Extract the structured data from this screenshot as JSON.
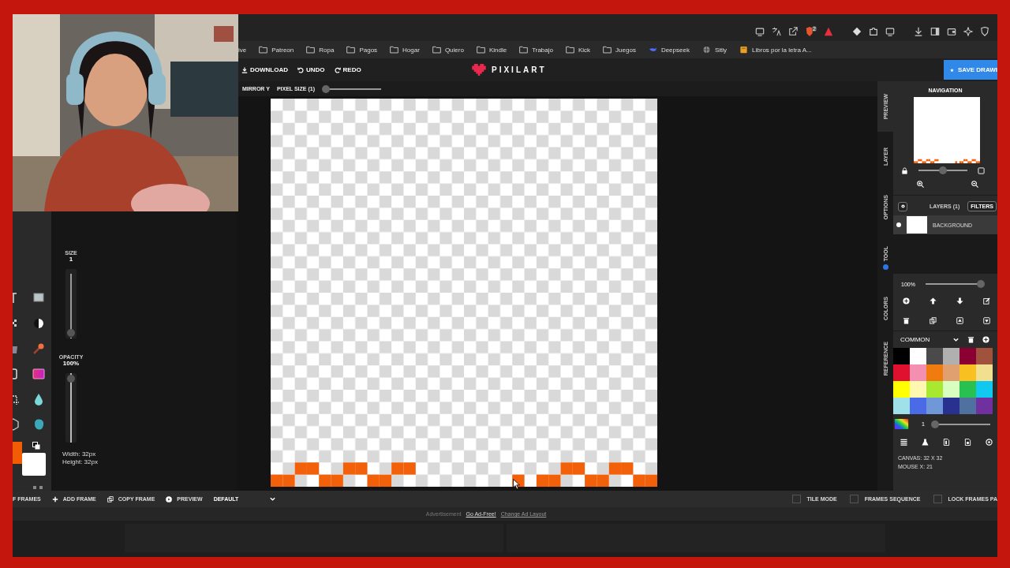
{
  "webcam": {
    "kind": "picture"
  },
  "browser": {
    "badge": "2",
    "bookmarks": [
      {
        "kind": "plain",
        "label": "ive"
      },
      {
        "kind": "folder",
        "label": "Patreon"
      },
      {
        "kind": "folder",
        "label": "Ropa"
      },
      {
        "kind": "folder",
        "label": "Pagos"
      },
      {
        "kind": "folder",
        "label": "Hogar"
      },
      {
        "kind": "folder",
        "label": "Quiero"
      },
      {
        "kind": "folder",
        "label": "Kindle"
      },
      {
        "kind": "folder",
        "label": "Trabajo"
      },
      {
        "kind": "folder",
        "label": "Kick"
      },
      {
        "kind": "folder",
        "label": "Juegos"
      },
      {
        "kind": "whale",
        "label": "Deepseek"
      },
      {
        "kind": "globe",
        "label": "Sitly"
      },
      {
        "kind": "book",
        "label": "Libros por la letra A..."
      }
    ]
  },
  "app_toolbar": {
    "buttons": [
      {
        "kind": "download",
        "label": "DOWNLOAD"
      },
      {
        "kind": "undo",
        "label": "UNDO"
      },
      {
        "kind": "redo",
        "label": "REDO"
      }
    ],
    "logo": "PIXILART",
    "save_button": "SAVE DRAWI"
  },
  "options_bar": {
    "mirror": "MIRROR Y",
    "pixel_size": {
      "label": "PIXEL SIZE (1)",
      "level": 0
    }
  },
  "tool_sidebar": {
    "size": {
      "label": "SIZE",
      "value": "1",
      "level": 0
    },
    "opacity": {
      "label": "OPACITY",
      "value": "100%",
      "level": 1
    },
    "width": "Width: 32px",
    "height": "Height: 32px",
    "primary": {
      "color": "#f25c05"
    },
    "secondary": {
      "color": "#ffffff"
    }
  },
  "right_tabs": [
    {
      "label": "PREVIEW",
      "selected": true,
      "dot": false
    },
    {
      "label": "LAYER",
      "selected": false,
      "dot": false
    },
    {
      "label": "OPTIONS",
      "selected": false,
      "dot": false
    },
    {
      "label": "TOOL",
      "selected": false,
      "dot": true
    },
    {
      "label": "COLORS",
      "selected": false,
      "dot": false
    },
    {
      "label": "REFERENCE",
      "selected": false,
      "dot": false
    }
  ],
  "navigation": {
    "title": "NAVIGATION",
    "zoom": {
      "level": 0.5
    }
  },
  "layers": {
    "title": "LAYERS (1)",
    "filters": "FILTERS",
    "items": [
      {
        "name": "BACKGROUND",
        "visible": true
      }
    ],
    "opacity": {
      "value": "100%",
      "level": 1
    }
  },
  "palette": {
    "name": "COMMON",
    "colors": [
      {
        "color": "#000000"
      },
      {
        "color": "#ffffff"
      },
      {
        "color": "#4a4a4a"
      },
      {
        "color": "#b0b0b0"
      },
      {
        "color": "#8b0033"
      },
      {
        "color": "#a0523d"
      },
      {
        "color": "#e0102f"
      },
      {
        "color": "#f48fb1"
      },
      {
        "color": "#f07c10"
      },
      {
        "color": "#e0a070"
      },
      {
        "color": "#f8c020"
      },
      {
        "color": "#f0e090"
      },
      {
        "color": "#ffff00"
      },
      {
        "color": "#fff8b0"
      },
      {
        "color": "#a8e830"
      },
      {
        "color": "#d8ffc0"
      },
      {
        "color": "#28c050"
      },
      {
        "color": "#10c8f0"
      },
      {
        "color": "#a0e0e8"
      },
      {
        "color": "#4a6ae8"
      },
      {
        "color": "#7098d8"
      },
      {
        "color": "#283090"
      },
      {
        "color": "#5070a0"
      },
      {
        "color": "#7030a0"
      }
    ],
    "brush": {
      "value": "1",
      "level": 0
    }
  },
  "status": [
    "CANVAS: 32 X 32",
    "MOUSE X: 21"
  ],
  "frames_bar": {
    "items": [
      {
        "kind": "text",
        "label": "F FRAMES"
      },
      {
        "kind": "add",
        "label": "ADD FRAME"
      },
      {
        "kind": "copy",
        "label": "COPY FRAME"
      },
      {
        "kind": "play",
        "label": "PREVIEW"
      }
    ],
    "mode": "DEFAULT",
    "toggles": [
      {
        "label": "TILE MODE",
        "checked": false
      },
      {
        "label": "FRAMES SEQUENCE",
        "checked": false
      },
      {
        "label": "LOCK FRAMES PA",
        "checked": false
      }
    ]
  },
  "ad_bar": {
    "label": "Advertisement",
    "links": [
      "Go Ad-Free!",
      "Change Ad Layout"
    ]
  }
}
